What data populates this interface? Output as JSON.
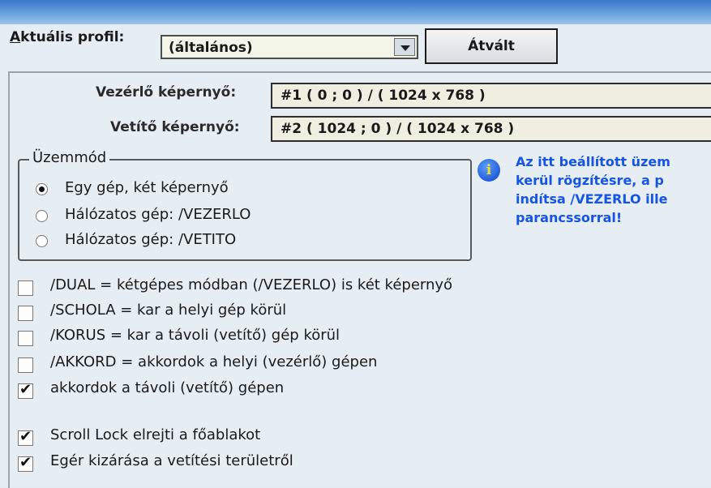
{
  "profile": {
    "label": "Aktuális profil:",
    "label_accesskey": "A",
    "label_rest": "ktuális profil:",
    "selected": "(általános)",
    "switch_button": "Átvált"
  },
  "screens": {
    "control_label": "Vezérlő képernyő:",
    "control_value": "#1 ( 0 ; 0 ) / ( 1024 x 768 )",
    "projector_label": "Vetítő képernyő:",
    "projector_value": "#2 ( 1024 ; 0 ) / ( 1024 x 768 )"
  },
  "mode": {
    "title": "Üzemmód",
    "options": [
      {
        "label": "Egy gép, két képernyő",
        "selected": true
      },
      {
        "label": "Hálózatos gép: /VEZERLO",
        "selected": false
      },
      {
        "label": "Hálózatos gép: /VETITO",
        "selected": false
      }
    ]
  },
  "info": {
    "icon": "info-icon",
    "lines": [
      "Az itt beállított üzem",
      "kerül rögzítésre, a p",
      "indítsa /VEZERLO ille",
      "parancssorral!"
    ]
  },
  "options": [
    {
      "label": "/DUAL = kétgépes módban (/VEZERLO) is két képernyő",
      "checked": false
    },
    {
      "label": "/SCHOLA = kar a helyi gép körül",
      "checked": false
    },
    {
      "label": "/KORUS = kar a távoli (vetítő) gép körül",
      "checked": false
    },
    {
      "label": "/AKKORD = akkordok a helyi (vezérlő) gépen",
      "checked": false
    },
    {
      "label": "akkordok a távoli (vetítő) gépen",
      "checked": true
    },
    {
      "label": "Scroll Lock elrejti a főablakot",
      "checked": true
    },
    {
      "label": "Egér kizárása a vetítési területről",
      "checked": true
    }
  ],
  "colors": {
    "info_text": "#1455e6",
    "titlebar": "#3a78c8"
  }
}
